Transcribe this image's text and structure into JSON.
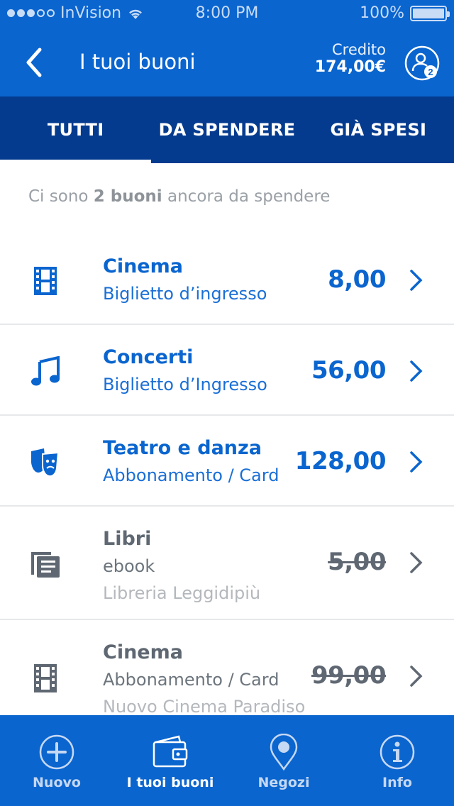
{
  "status_bar": {
    "carrier": "InVision",
    "time": "8:00 PM",
    "battery": "100%"
  },
  "header": {
    "title": "I tuoi buoni",
    "credit_label": "Credito",
    "credit_amount": "174,00€",
    "profile_badge": "2"
  },
  "tabs": [
    {
      "label": "TUTTI",
      "active": true
    },
    {
      "label": "DA SPENDERE",
      "active": false
    },
    {
      "label": "GIÀ SPESI",
      "active": false
    }
  ],
  "summary": {
    "prefix": "Ci sono",
    "highlight": "2 buoni",
    "suffix": "ancora da spendere"
  },
  "vouchers": [
    {
      "icon": "film-icon",
      "title": "Cinema",
      "subtitle": "Biglietto d’ingresso",
      "price": "8,00",
      "spent": false
    },
    {
      "icon": "music-icon",
      "title": "Concerti",
      "subtitle": "Biglietto d’Ingresso",
      "price": "56,00",
      "spent": false
    },
    {
      "icon": "theater-masks-icon",
      "title": "Teatro e danza",
      "subtitle": "Abbonamento / Card",
      "price": "128,00",
      "spent": false
    },
    {
      "icon": "books-icon",
      "title": "Libri",
      "subtitle": "ebook",
      "vendor": "Libreria Leggidipiù",
      "price": "5,00",
      "spent": true
    },
    {
      "icon": "film-icon",
      "title": "Cinema",
      "subtitle": "Abbonamento / Card",
      "vendor": "Nuovo Cinema Paradiso",
      "price": "99,00",
      "spent": true
    }
  ],
  "tab_bar": [
    {
      "label": "Nuovo",
      "icon": "plus-circle-icon",
      "active": false
    },
    {
      "label": "I tuoi buoni",
      "icon": "wallet-icon",
      "active": true
    },
    {
      "label": "Negozi",
      "icon": "map-pin-icon",
      "active": false
    },
    {
      "label": "Info",
      "icon": "info-circle-icon",
      "active": false
    }
  ],
  "colors": {
    "primary": "#0a65cf",
    "tabs_bg": "#053b8f",
    "spent": "#5f6872"
  }
}
